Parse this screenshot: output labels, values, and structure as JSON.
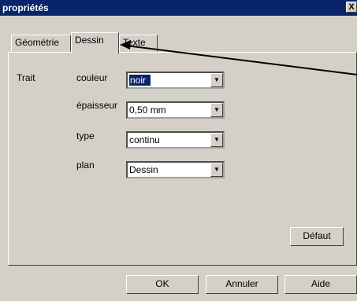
{
  "window": {
    "title": "propriétés",
    "close_glyph": "X"
  },
  "tabs": [
    {
      "label": "Géométrie",
      "active": false
    },
    {
      "label": "Dessin",
      "active": true
    },
    {
      "label": "Texte",
      "active": false
    }
  ],
  "section": {
    "label": "Trait"
  },
  "fields": [
    {
      "label": "couleur",
      "value": "noir",
      "selected": true,
      "icon": "chevron-down-icon"
    },
    {
      "label": "épaisseur",
      "value": "0,50 mm",
      "selected": false,
      "icon": "chevron-down-icon"
    },
    {
      "label": "type",
      "value": "continu",
      "selected": false,
      "icon": "chevron-down-icon"
    },
    {
      "label": "plan",
      "value": "Dessin",
      "selected": false,
      "icon": "chevron-down-icon"
    }
  ],
  "buttons": {
    "default": "Défaut",
    "ok": "OK",
    "cancel": "Annuler",
    "help": "Aide"
  },
  "colors": {
    "titlebar": "#0a246a",
    "face": "#d4d0c8",
    "selection": "#0a246a"
  }
}
